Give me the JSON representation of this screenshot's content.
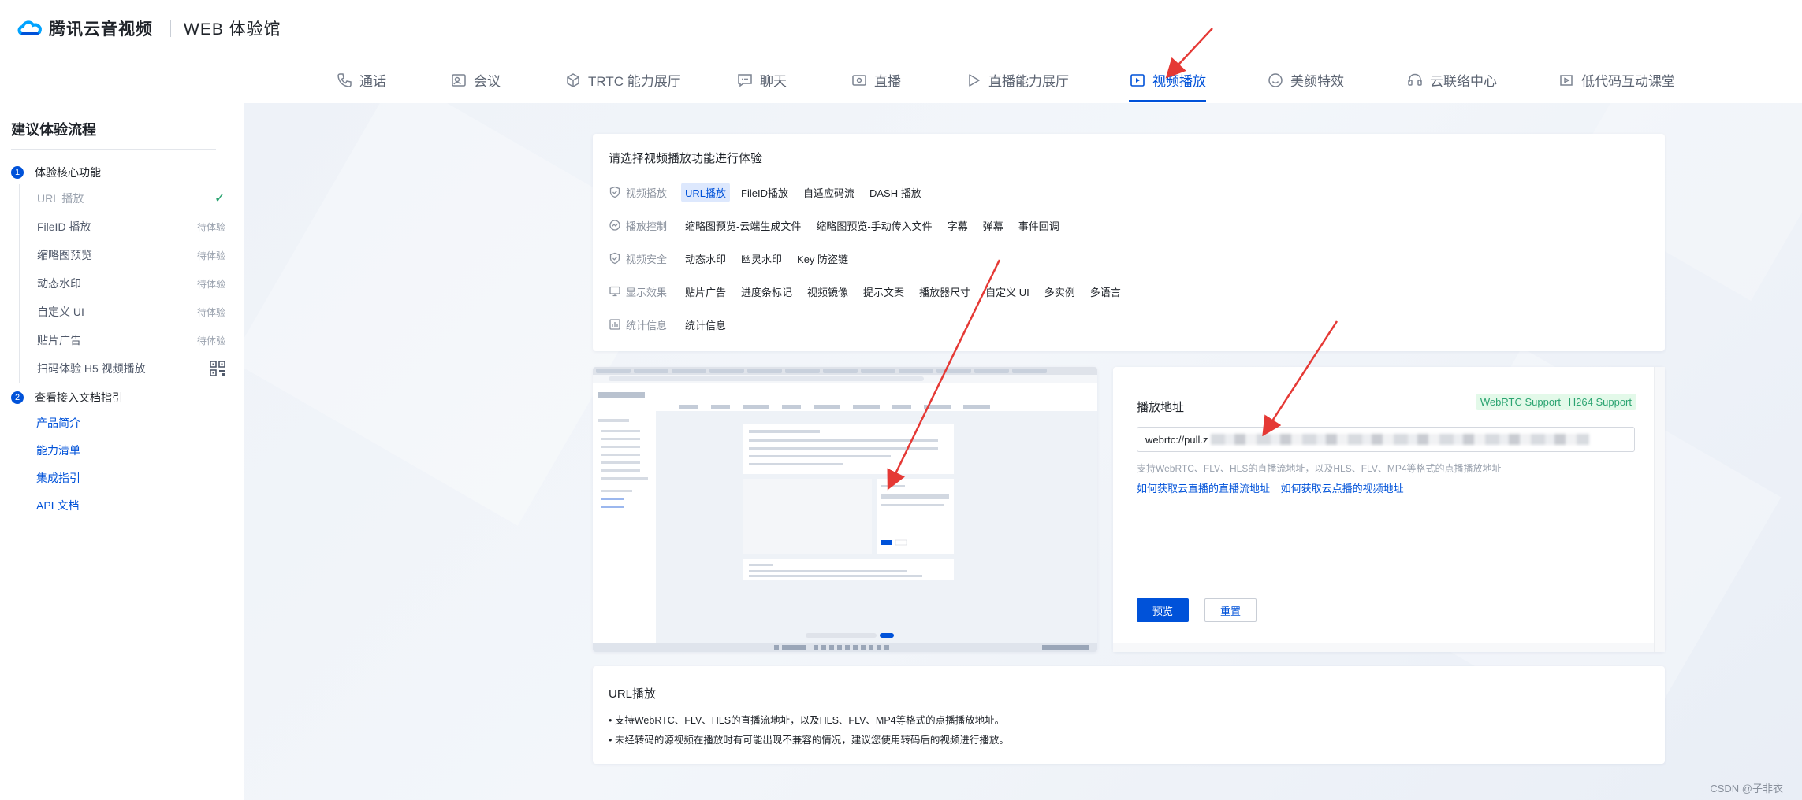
{
  "header": {
    "brand": "腾讯云音视频",
    "subtitle": "WEB 体验馆"
  },
  "nav": {
    "items": [
      {
        "label": "通话",
        "icon": "phone-icon"
      },
      {
        "label": "会议",
        "icon": "meeting-icon"
      },
      {
        "label": "TRTC 能力展厅",
        "icon": "cube-icon"
      },
      {
        "label": "聊天",
        "icon": "chat-icon"
      },
      {
        "label": "直播",
        "icon": "live-icon"
      },
      {
        "label": "直播能力展厅",
        "icon": "play-circle-icon"
      },
      {
        "label": "视频播放",
        "icon": "video-play-icon",
        "active": true
      },
      {
        "label": "美颜特效",
        "icon": "beauty-icon"
      },
      {
        "label": "云联络中心",
        "icon": "headset-icon"
      },
      {
        "label": "低代码互动课堂",
        "icon": "classroom-icon"
      }
    ]
  },
  "sidebar": {
    "title": "建议体验流程",
    "step1": {
      "num": "1",
      "label": "体验核心功能"
    },
    "items": [
      {
        "label": "URL 播放",
        "status": ""
      },
      {
        "label": "FileID 播放",
        "status": "待体验"
      },
      {
        "label": "缩略图预览",
        "status": "待体验"
      },
      {
        "label": "动态水印",
        "status": "待体验"
      },
      {
        "label": "自定义 UI",
        "status": "待体验"
      },
      {
        "label": "贴片广告",
        "status": "待体验"
      },
      {
        "label": "扫码体验 H5 视频播放",
        "status": ""
      }
    ],
    "step2": {
      "num": "2",
      "label": "查看接入文档指引"
    },
    "docs": [
      "产品简介",
      "能力清单",
      "集成指引",
      "API 文档"
    ]
  },
  "select_card": {
    "title": "请选择视频播放功能进行体验",
    "rows": [
      {
        "label": "视频播放",
        "tags": [
          "URL播放",
          "FileID播放",
          "自适应码流",
          "DASH 播放"
        ]
      },
      {
        "label": "播放控制",
        "tags": [
          "缩略图预览-云端生成文件",
          "缩略图预览-手动传入文件",
          "字幕",
          "弹幕",
          "事件回调"
        ]
      },
      {
        "label": "视频安全",
        "tags": [
          "动态水印",
          "幽灵水印",
          "Key 防盗链"
        ]
      },
      {
        "label": "显示效果",
        "tags": [
          "贴片广告",
          "进度条标记",
          "视频镜像",
          "提示文案",
          "播放器尺寸",
          "自定义 UI",
          "多实例",
          "多语言"
        ]
      },
      {
        "label": "统计信息",
        "tags": [
          "统计信息"
        ]
      }
    ]
  },
  "form": {
    "title": "播放地址",
    "badge_webrtc": "WebRTC Support",
    "badge_h264": "H264 Support",
    "url_value": "webrtc://pull.z",
    "hint": "支持WebRTC、FLV、HLS的直播流地址，以及HLS、FLV、MP4等格式的点播播放地址",
    "link_live": "如何获取云直播的直播流地址",
    "link_vod": "如何获取云点播的视频地址",
    "btn_preview": "预览",
    "btn_reset": "重置"
  },
  "desc": {
    "title": "URL播放",
    "lines": [
      "支持WebRTC、FLV、HLS的直播流地址，以及HLS、FLV、MP4等格式的点播播放地址。",
      "未经转码的源视频在播放时有可能出现不兼容的情况，建议您使用转码后的视频进行播放。"
    ]
  },
  "watermark": "CSDN @子非衣",
  "colors": {
    "accent": "#0052d9",
    "success": "#2ba471",
    "arrow": "#e53935"
  }
}
